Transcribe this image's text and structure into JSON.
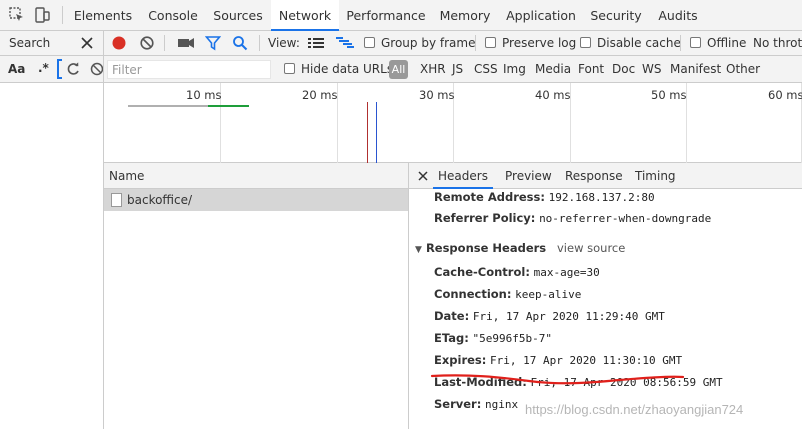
{
  "toolbar_tabs": [
    "Elements",
    "Console",
    "Sources",
    "Network",
    "Performance",
    "Memory",
    "Application",
    "Security",
    "Audits"
  ],
  "active_tab": "Network",
  "search_panel": {
    "label": "Search",
    "aa": "Aa",
    "regex": ".*"
  },
  "net_toolbar": {
    "view_label": "View:",
    "group_by_frame": "Group by frame",
    "preserve_log": "Preserve log",
    "disable_cache": "Disable cache",
    "offline": "Offline",
    "throttle": "No thrott"
  },
  "filter_bar": {
    "placeholder": "Filter",
    "hide_data_urls": "Hide data URLs",
    "types": [
      "All",
      "XHR",
      "JS",
      "CSS",
      "Img",
      "Media",
      "Font",
      "Doc",
      "WS",
      "Manifest",
      "Other"
    ]
  },
  "timeline": {
    "ticks": [
      "10 ms",
      "20 ms",
      "30 ms",
      "40 ms",
      "50 ms",
      "60 ms"
    ]
  },
  "request_list": {
    "column_name": "Name",
    "rows": [
      "backoffice/"
    ]
  },
  "detail_tabs": [
    "Headers",
    "Preview",
    "Response",
    "Timing"
  ],
  "general": [
    {
      "name": "Remote Address:",
      "value": "192.168.137.2:80"
    },
    {
      "name": "Referrer Policy:",
      "value": "no-referrer-when-downgrade"
    }
  ],
  "response_headers": {
    "title": "Response Headers",
    "view_source": "view source",
    "items": [
      {
        "name": "Cache-Control:",
        "value": "max-age=30"
      },
      {
        "name": "Connection:",
        "value": "keep-alive"
      },
      {
        "name": "Date:",
        "value": "Fri, 17 Apr 2020 11:29:40 GMT"
      },
      {
        "name": "ETag:",
        "value": "\"5e996f5b-7\""
      },
      {
        "name": "Expires:",
        "value": "Fri, 17 Apr 2020 11:30:10 GMT"
      },
      {
        "name": "Last-Modified:",
        "value": "Fri, 17 Apr 2020 08:56:59 GMT"
      },
      {
        "name": "Server:",
        "value": "nginx"
      }
    ]
  },
  "watermark": "https://blog.csdn.net/zhaoyangjian724",
  "colors": {
    "accent": "#1a73e8",
    "record": "#d93025",
    "annotation": "#e0201b"
  }
}
